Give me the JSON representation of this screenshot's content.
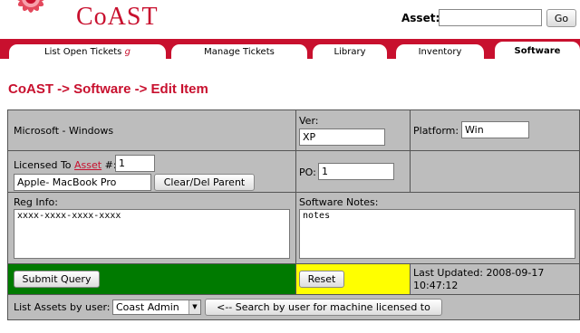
{
  "header": {
    "app_title": "CoAST",
    "asset_label": "Asset:",
    "asset_value": "",
    "go_label": "Go"
  },
  "nav": {
    "tabs": [
      {
        "label": "List Open Tickets",
        "suffix": "g"
      },
      {
        "label": "Manage Tickets"
      },
      {
        "label": "Library"
      },
      {
        "label": "Inventory"
      },
      {
        "label": "Software"
      }
    ],
    "active_tab": "Software"
  },
  "page": {
    "heading": "CoAST -> Software -> Edit Item"
  },
  "form": {
    "software_name": "Microsoft - Windows",
    "ver_label": "Ver:",
    "ver_value": "XP",
    "platform_label": "Platform:",
    "platform_value": "Win",
    "licensed_to_label": "Licensed To",
    "asset_link": "Asset",
    "number_label": "#:",
    "licensed_number": "1",
    "parent_value": "Apple- MacBook Pro",
    "clear_parent_label": "Clear/Del Parent",
    "po_label": "PO:",
    "po_value": "1",
    "reg_info_label": "Reg Info:",
    "reg_info_value": "xxxx-xxxx-xxxx-xxxx",
    "notes_label": "Software Notes:",
    "notes_value": "notes",
    "submit_label": "Submit Query",
    "reset_label": "Reset",
    "last_updated_label": "Last Updated:",
    "last_updated_date": "2008-09-17",
    "last_updated_time": "10:47:12",
    "list_assets_label": "List Assets by user:",
    "user_selected": "Coast Admin",
    "search_user_label": "<-- Search by user for machine licensed to"
  },
  "colors": {
    "brand": "#c8102e",
    "submit_cell": "#007a00",
    "reset_cell": "#ffff00",
    "form_bg": "#bdbdbd"
  }
}
